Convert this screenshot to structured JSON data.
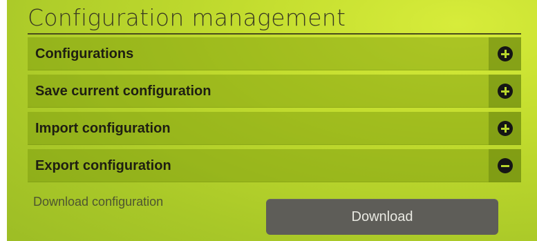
{
  "page": {
    "title": "Configuration management"
  },
  "sections": [
    {
      "label": "Configurations",
      "state": "collapsed",
      "icon": "plus-circle-icon"
    },
    {
      "label": "Save current configuration",
      "state": "collapsed",
      "icon": "plus-circle-icon"
    },
    {
      "label": "Import configuration",
      "state": "collapsed",
      "icon": "plus-circle-icon"
    },
    {
      "label": "Export configuration",
      "state": "expanded",
      "icon": "minus-circle-icon"
    }
  ],
  "export": {
    "download_label": "Download configuration",
    "download_button": "Download"
  },
  "colors": {
    "background": "#b9d62c",
    "header_bar": "#96b41e",
    "button": "#5e5d58",
    "icon": "#151515"
  }
}
